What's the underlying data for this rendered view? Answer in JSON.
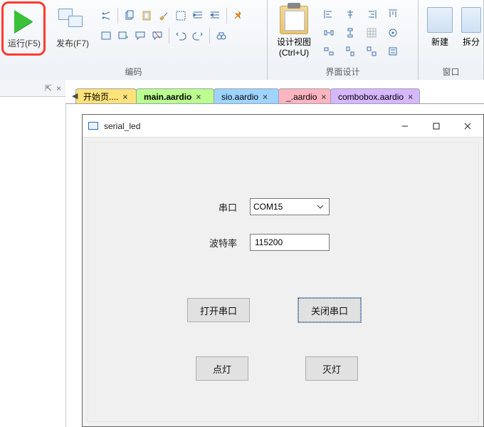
{
  "ribbon": {
    "run": {
      "label": "运行(F5)"
    },
    "publish": {
      "label": "发布(F7)"
    },
    "encode_group": "编码",
    "design_group": "界面设计",
    "design_view": {
      "line1": "设计视图",
      "line2": "(Ctrl+U)"
    },
    "new_group": "窗口",
    "new_btn": "新建",
    "split_btn": "拆分"
  },
  "sidebar": {
    "pin": "⇱",
    "close": "×"
  },
  "tabs": [
    {
      "label": "开始页...."
    },
    {
      "label": "main.aardio"
    },
    {
      "label": "sio.aardio"
    },
    {
      "label": "_.aardio"
    },
    {
      "label": "combobox.aardio"
    }
  ],
  "app": {
    "title": "serial_led",
    "labels": {
      "port": "串口",
      "baud": "波特率"
    },
    "port": {
      "value": "COM15"
    },
    "baud": {
      "value": "115200"
    },
    "buttons": {
      "open": "打开串口",
      "close": "关闭串口",
      "on": "点灯",
      "off": "灭灯"
    },
    "wincontrols": {
      "min": "–",
      "max": "□",
      "close": "×"
    }
  },
  "icons": {
    "scissors": "scissors",
    "copy": "copy",
    "paste": "paste",
    "brush": "brush",
    "pin": "pin",
    "undo": "undo",
    "redo": "redo",
    "find": "find"
  }
}
